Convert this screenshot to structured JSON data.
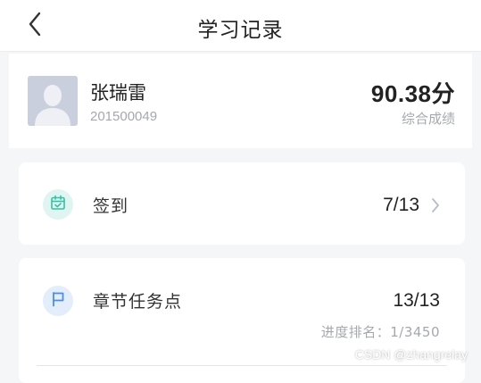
{
  "header": {
    "title": "学习记录",
    "back_icon": "chevron-left-icon"
  },
  "profile": {
    "name": "张瑞雷",
    "student_id": "201500049",
    "score": "90.38分",
    "score_label": "综合成绩",
    "avatar_icon": "user-placeholder-icon"
  },
  "checkin": {
    "label": "签到",
    "value": "7/13",
    "icon": "calendar-check-icon",
    "icon_color": "#35c2a4"
  },
  "tasks": {
    "label": "章节任务点",
    "value": "13/13",
    "rank": "进度排名：1/3450",
    "icon": "flag-icon",
    "icon_color": "#4a8ee8"
  },
  "watermark": "CSDN @zhangrelay"
}
